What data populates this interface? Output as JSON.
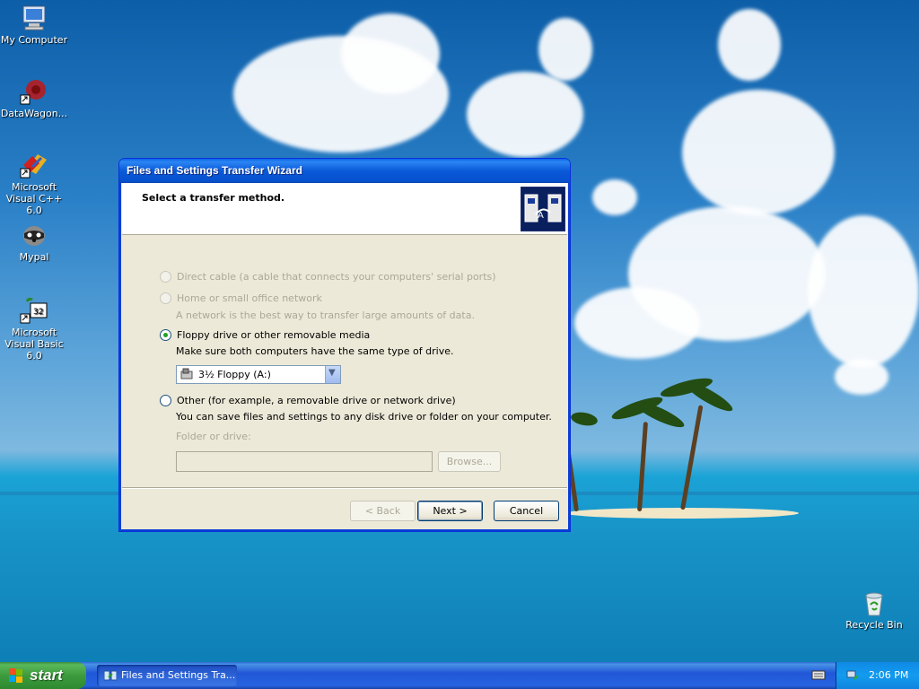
{
  "desktop": {
    "icons": [
      {
        "label": "My Computer",
        "icon": "my-computer-icon"
      },
      {
        "label": "DataWagon...",
        "icon": "datawagon-icon"
      },
      {
        "label": "Microsoft Visual C++ 6.0",
        "icon": "visual-cpp-icon"
      },
      {
        "label": "Mypal",
        "icon": "mypal-icon"
      },
      {
        "label": "Microsoft Visual Basic 6.0",
        "icon": "visual-basic-icon"
      },
      {
        "label": "Recycle Bin",
        "icon": "recycle-bin-icon"
      }
    ]
  },
  "wizard": {
    "title": "Files and Settings Transfer Wizard",
    "heading": "Select a transfer method.",
    "options": {
      "direct_cable": {
        "label": "Direct cable (a cable that connects your computers' serial ports)",
        "enabled": false,
        "checked": false
      },
      "home_network": {
        "label": "Home or small office network",
        "enabled": false,
        "checked": false,
        "description": "A network is the best way to transfer large amounts of data."
      },
      "floppy": {
        "label": "Floppy drive or other removable media",
        "enabled": true,
        "checked": true,
        "description": "Make sure both computers have the same type of drive."
      },
      "other": {
        "label": "Other (for example, a removable drive or network drive)",
        "enabled": true,
        "checked": false,
        "description": "You can save files and settings to any disk drive or folder on your computer."
      }
    },
    "drive_select": {
      "value": "3½ Floppy (A:)"
    },
    "folder": {
      "label": "Folder or drive:",
      "value": ""
    },
    "browse_label": "Browse...",
    "back_label": "< Back",
    "next_label": "Next >",
    "cancel_label": "Cancel"
  },
  "taskbar": {
    "start_label": "start",
    "task_label": "Files and Settings Tra...",
    "clock": "2:06 PM"
  }
}
